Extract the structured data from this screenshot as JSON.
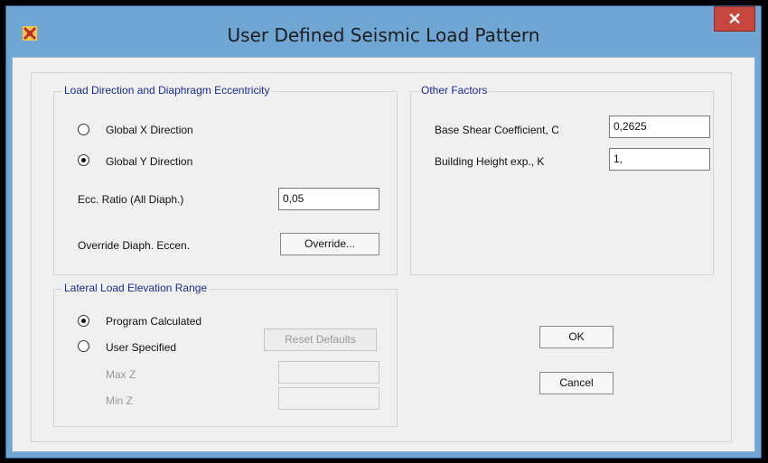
{
  "window": {
    "title": "User Defined Seismic Load Pattern",
    "close_symbol": "✕",
    "app_icon": "sap-app-icon"
  },
  "load_direction": {
    "title": "Load Direction and Diaphragm Eccentricity",
    "global_x_label": "Global  X  Direction",
    "global_y_label": "Global  Y  Direction",
    "selected": "Global Y",
    "ecc_ratio_label": "Ecc. Ratio (All Diaph.)",
    "ecc_ratio_value": "0,05",
    "override_label": "Override Diaph. Eccen.",
    "override_button": "Override..."
  },
  "other_factors": {
    "title": "Other Factors",
    "base_shear_label": "Base Shear Coefficient, C",
    "base_shear_value": "0,2625",
    "building_height_label": "Building Height exp., K",
    "building_height_value": "1,"
  },
  "lateral_load": {
    "title": "Lateral Load Elevation Range",
    "program_calculated_label": "Program Calculated",
    "user_specified_label": "User Specified",
    "selected": "Program Calculated",
    "reset_defaults_button": "Reset Defaults",
    "max_z_label": "Max Z",
    "min_z_label": "Min Z",
    "max_z_value": "",
    "min_z_value": ""
  },
  "buttons": {
    "ok": "OK",
    "cancel": "Cancel"
  }
}
